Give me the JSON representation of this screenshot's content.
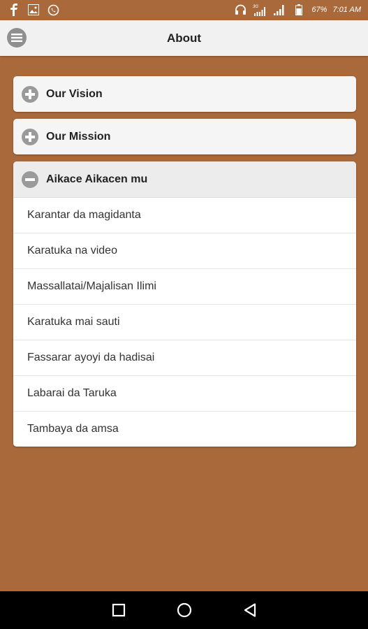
{
  "status_bar": {
    "left_icons": [
      "facebook-icon",
      "image-icon",
      "whatsapp-icon"
    ],
    "right_icons": [
      "headphones-icon",
      "signal-3g-icon",
      "signal-icon",
      "battery-icon"
    ],
    "battery_text": "67%",
    "time_text": "7:01 AM"
  },
  "header": {
    "title": "About",
    "menu_icon": "menu-icon"
  },
  "accordion": [
    {
      "title": "Our Vision",
      "expanded": false
    },
    {
      "title": "Our Mission",
      "expanded": false
    },
    {
      "title": "Aikace Aikacen mu",
      "expanded": true,
      "items": [
        "Karantar da magidanta",
        "Karatuka na video",
        "Massallatai/Majalisan Ilimi",
        "Karatuka mai sauti",
        "Fassarar ayoyi da hadisai",
        "Labarai da Taruka",
        "Tambaya da amsa"
      ]
    }
  ],
  "nav_bar": {
    "buttons": [
      "recents-square-icon",
      "home-circle-icon",
      "back-triangle-icon"
    ]
  },
  "colors": {
    "background": "#a9693b",
    "header_bg": "#f1f1f1",
    "card_bg": "#f5f5f5",
    "icon_grey": "#9a9a9a"
  }
}
